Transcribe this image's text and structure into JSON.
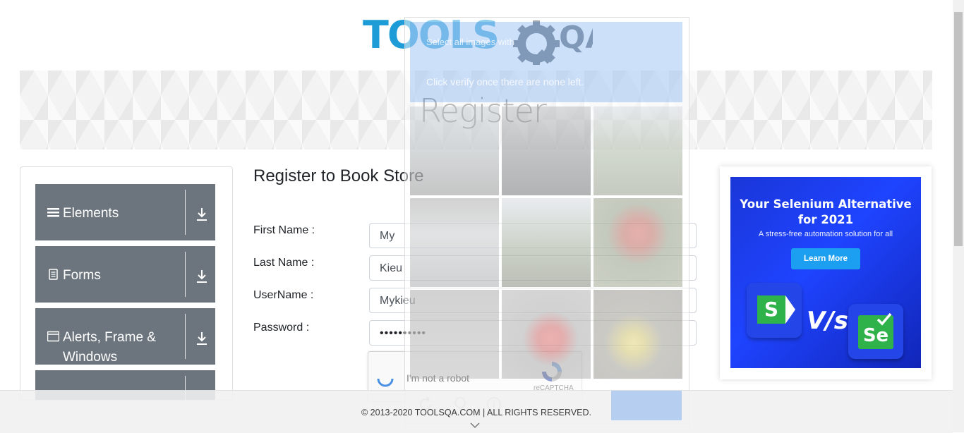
{
  "logo": {
    "text_part1": "TOOLS",
    "text_part2": "QA"
  },
  "banner": {
    "title": "Register"
  },
  "sidebar": {
    "groups": [
      {
        "label": "Elements",
        "icon": "hamburger-icon"
      },
      {
        "label": "Forms",
        "icon": "document-icon"
      },
      {
        "label": "Alerts, Frame & Windows",
        "icon": "window-icon"
      },
      {
        "label": "",
        "icon": ""
      }
    ]
  },
  "page": {
    "title": "Register to Book Store"
  },
  "form": {
    "first_name_label": "First Name :",
    "first_name_value": "My",
    "last_name_label": "Last Name :",
    "last_name_value": "Kieu",
    "username_label": "UserName :",
    "username_value": "Mykieu",
    "password_label": "Password :",
    "password_value": "••••••••••"
  },
  "recaptcha": {
    "checkbox_label": "I'm not a robot",
    "brand": "reCAPTCHA"
  },
  "captcha_challenge": {
    "instruction": "Select all images with",
    "sub_instruction": "Click verify once there are none left."
  },
  "ad": {
    "headline_line1": "Your Selenium Alternative",
    "headline_line2": "for 2021",
    "subtext": "A stress-free automation solution for all",
    "button": "Learn More",
    "vs_text": "V/s",
    "s_letter": "S",
    "se_letter": "Se"
  },
  "footer": {
    "copyright": "© 2013-2020 TOOLSQA.COM | ALL RIGHTS RESERVED."
  },
  "colors": {
    "sidebar_bg": "#6c757d",
    "accent_blue": "#1b73e8",
    "ad_blue": "#1f44ff",
    "logo_blue": "#1e9cd7",
    "logo_dark": "#3d4b57"
  }
}
